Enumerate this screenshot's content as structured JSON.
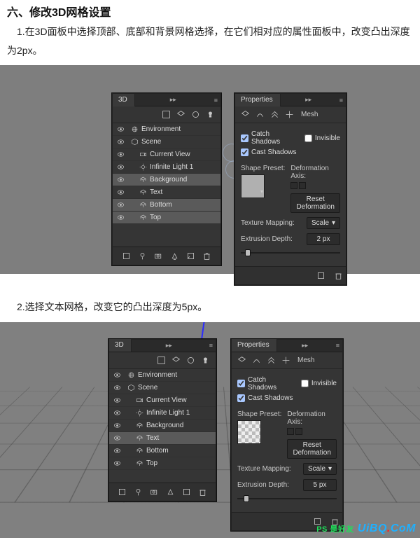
{
  "heading": "六、修改3D网格设置",
  "step1": "　1.在3D面板中选择顶部、底部和背景网格选择，在它们相对应的属性面板中，改变凸出深度为2px。",
  "step2": "　2.选择文本网格，改变它的凸出深度为5px。",
  "fig1": {
    "panel3d": {
      "title": "3D",
      "layers": [
        {
          "label": "Environment",
          "indent": 0,
          "icon": "globe",
          "selected": false,
          "eye": true
        },
        {
          "label": "Scene",
          "indent": 0,
          "icon": "cube",
          "selected": false,
          "eye": true
        },
        {
          "label": "Current View",
          "indent": 1,
          "icon": "camera",
          "selected": false,
          "eye": true
        },
        {
          "label": "Infinite Light 1",
          "indent": 1,
          "icon": "sun",
          "selected": false,
          "eye": true
        },
        {
          "label": "Background",
          "indent": 1,
          "icon": "mesh",
          "selected": true,
          "eye": true
        },
        {
          "label": "Text",
          "indent": 1,
          "icon": "mesh",
          "selected": false,
          "eye": true
        },
        {
          "label": "Bottom",
          "indent": 1,
          "icon": "mesh",
          "selected": true,
          "eye": true
        },
        {
          "label": "Top",
          "indent": 1,
          "icon": "mesh",
          "selected": true,
          "eye": true
        }
      ]
    },
    "props": {
      "title": "Properties",
      "mesh_label": "Mesh",
      "catch_shadows_label": "Catch Shadows",
      "catch_shadows": true,
      "invisible_label": "Invisible",
      "invisible": false,
      "cast_shadows_label": "Cast Shadows",
      "cast_shadows": true,
      "shape_preset_label": "Shape Preset:",
      "deformation_axis_label": "Deformation Axis:",
      "reset_btn": "Reset Deformation",
      "texture_mapping_label": "Texture Mapping:",
      "texture_mapping_value": "Scale",
      "extrusion_depth_label": "Extrusion Depth:",
      "extrusion_depth_value": "2 px",
      "slider_pos_pct": 4
    }
  },
  "fig2": {
    "panel3d": {
      "title": "3D",
      "layers": [
        {
          "label": "Environment",
          "indent": 0,
          "icon": "globe",
          "selected": false,
          "eye": true
        },
        {
          "label": "Scene",
          "indent": 0,
          "icon": "cube",
          "selected": false,
          "eye": true
        },
        {
          "label": "Current View",
          "indent": 1,
          "icon": "camera",
          "selected": false,
          "eye": true
        },
        {
          "label": "Infinite Light 1",
          "indent": 1,
          "icon": "sun",
          "selected": false,
          "eye": true
        },
        {
          "label": "Background",
          "indent": 1,
          "icon": "mesh",
          "selected": false,
          "eye": true
        },
        {
          "label": "Text",
          "indent": 1,
          "icon": "mesh",
          "selected": true,
          "eye": true
        },
        {
          "label": "Bottom",
          "indent": 1,
          "icon": "mesh",
          "selected": false,
          "eye": true
        },
        {
          "label": "Top",
          "indent": 1,
          "icon": "mesh",
          "selected": false,
          "eye": true
        }
      ]
    },
    "props": {
      "title": "Properties",
      "mesh_label": "Mesh",
      "catch_shadows_label": "Catch Shadows",
      "catch_shadows": true,
      "invisible_label": "Invisible",
      "invisible": false,
      "cast_shadows_label": "Cast Shadows",
      "cast_shadows": true,
      "shape_preset_label": "Shape Preset:",
      "deformation_axis_label": "Deformation Axis:",
      "reset_btn": "Reset Deformation",
      "texture_mapping_label": "Texture Mapping:",
      "texture_mapping_value": "Scale",
      "extrusion_depth_label": "Extrusion Depth:",
      "extrusion_depth_value": "5 px",
      "slider_pos_pct": 6
    }
  },
  "watermark": {
    "brand": "UiBQ",
    "dot": ".",
    "suffix": "CoM",
    "tag": "PS 是好友"
  }
}
